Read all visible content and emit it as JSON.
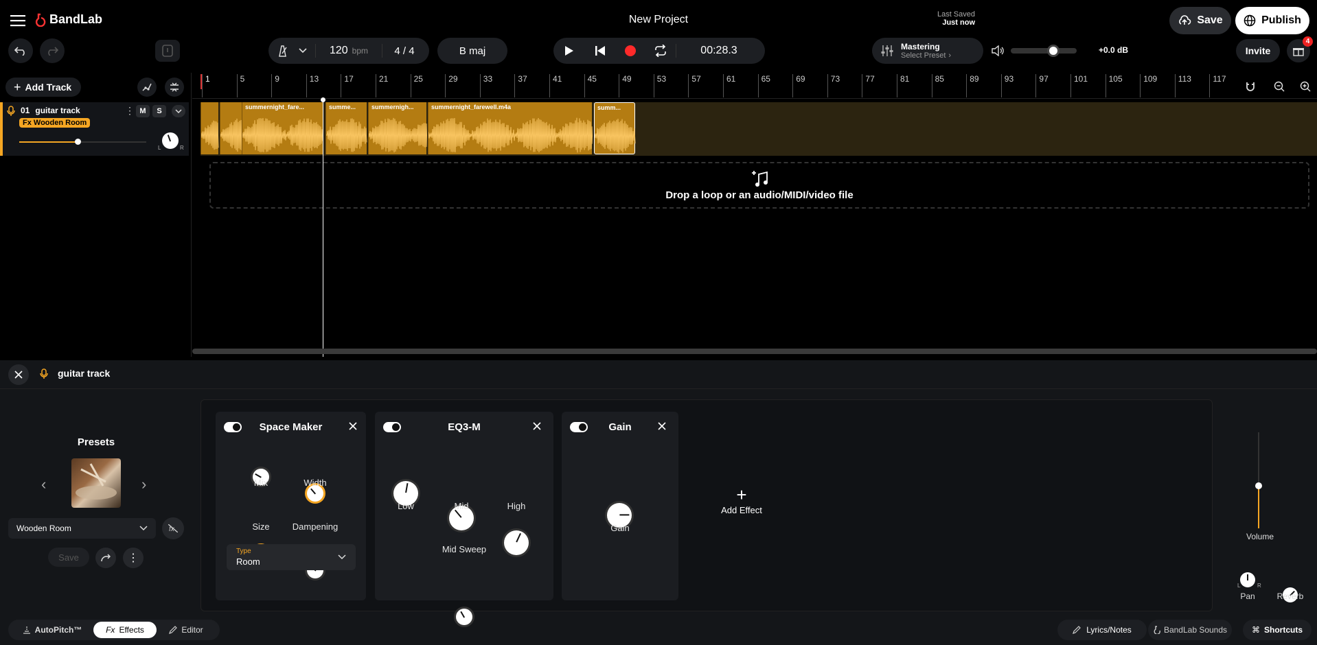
{
  "app": {
    "logo": "BandLab",
    "project_title": "New Project",
    "last_saved_label": "Last Saved",
    "last_saved_value": "Just now",
    "save": "Save",
    "publish": "Publish",
    "invite": "Invite",
    "gift_badge": "4"
  },
  "transport": {
    "bpm": "120",
    "bpm_unit": "bpm",
    "time_sig": "4 / 4",
    "key": "B maj",
    "time": "00:28.3"
  },
  "mastering": {
    "title": "Mastering",
    "preset": "Select Preset"
  },
  "master_volume": {
    "db": "+0.0 dB",
    "level": 0.65
  },
  "left": {
    "add_track": "Add Track"
  },
  "ruler": [
    "1",
    "5",
    "9",
    "13",
    "17",
    "21",
    "25",
    "29",
    "33",
    "37",
    "41",
    "45",
    "49",
    "53",
    "57",
    "61",
    "65",
    "69",
    "73",
    "77",
    "81",
    "85",
    "89",
    "93",
    "97",
    "101",
    "105",
    "109",
    "113",
    "117"
  ],
  "track": {
    "number": "01",
    "name": "guitar track",
    "fx_tag": "Fx Wooden Room",
    "mute": "M",
    "solo": "S"
  },
  "clips": [
    "summernight_fare...",
    "summe...",
    "summernigh...",
    "summernight_farewell.m4a",
    "summ..."
  ],
  "dropzone": "Drop a loop or an audio/MIDI/video file",
  "panel": {
    "track_name": "guitar track"
  },
  "presets": {
    "title": "Presets",
    "selected": "Wooden Room",
    "save": "Save"
  },
  "effects": [
    {
      "name": "Space Maker",
      "knobs": [
        "Mix",
        "Width",
        "Size",
        "Dampening"
      ],
      "type_label": "Type",
      "type_value": "Room"
    },
    {
      "name": "EQ3-M",
      "knobs": [
        "Low",
        "Mid",
        "High",
        "Mid Sweep"
      ]
    },
    {
      "name": "Gain",
      "knobs": [
        "Gain"
      ]
    }
  ],
  "add_effect": "Add Effect",
  "mixer": {
    "volume": "Volume",
    "pan": "Pan",
    "reverb": "Reverb",
    "pan_l": "L",
    "pan_r": "R"
  },
  "bottom": {
    "autopitch": "AutoPitch™",
    "effects": "Effects",
    "effects_prefix": "Fx",
    "editor": "Editor",
    "lyrics": "Lyrics/Notes",
    "sounds": "BandLab Sounds",
    "shortcuts": "Shortcuts"
  },
  "colors": {
    "accent": "#f5a623",
    "record": "#ff2a2a",
    "clip": "#b47c12"
  }
}
